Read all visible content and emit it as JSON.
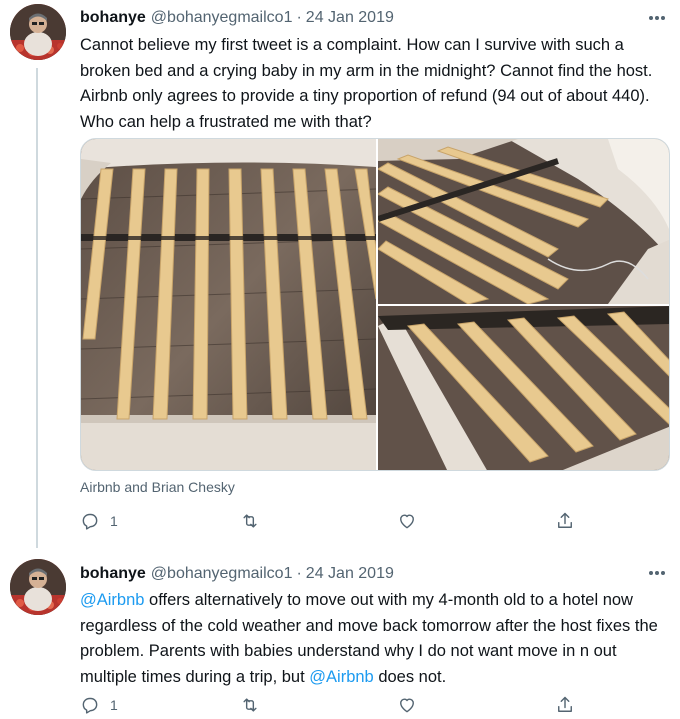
{
  "tweets": [
    {
      "author": {
        "name": "bohanye",
        "handle": "@bohanyegmailco1"
      },
      "separator": "·",
      "date": "24 Jan 2019",
      "text": "Cannot believe my first tweet is a complaint. How can I survive with such a broken bed and a crying baby in my arm in the midnight? Cannot find the host. Airbnb only agrees to provide a tiny proportion of refund (94 out of about 440). Who can help a frustrated me with that?",
      "tagged_people": "Airbnb and Brian Chesky",
      "actions": {
        "replies": "1",
        "retweets": "",
        "likes": ""
      },
      "icons": {
        "more": "more-dots-icon",
        "reply": "reply-icon",
        "retweet": "retweet-icon",
        "like": "heart-icon",
        "share": "share-icon"
      }
    },
    {
      "author": {
        "name": "bohanye",
        "handle": "@bohanyegmailco1"
      },
      "separator": "·",
      "date": "24 Jan 2019",
      "text_parts": {
        "mention_1": "@Airbnb",
        "body_1": " offers alternatively to move out with my 4-month old to a hotel now regardless of the cold weather and move back tomorrow after the host fixes the problem. Parents with babies understand why I do not want move in n out multiple times during a trip, but ",
        "mention_2": "@Airbnb",
        "body_2": " does not."
      },
      "actions": {
        "replies": "1",
        "retweets": "",
        "likes": ""
      }
    }
  ],
  "colors": {
    "text": "#0f1419",
    "secondary": "#536471",
    "mention": "#1d9bf0",
    "border": "#cfd9de",
    "background": "#ffffff"
  }
}
